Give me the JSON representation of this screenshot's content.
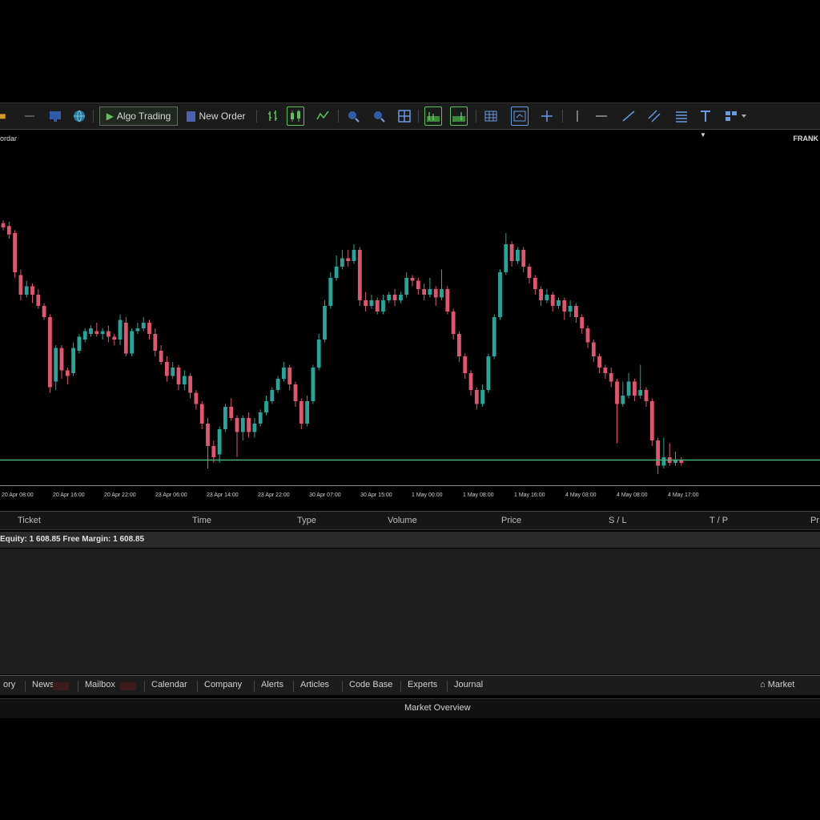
{
  "toolbar": {
    "algo_trading_label": "Algo Trading",
    "new_order_label": "New Order"
  },
  "subbar": {
    "left_label": "ordar",
    "right_label": "FRANK"
  },
  "chart_data": {
    "type": "candlestick",
    "colors": {
      "up": "#26a69a",
      "down": "#e05570",
      "background": "#000000",
      "price_line": "#4caf7a"
    },
    "x_tick_labels": [
      "20 Apr 08:00",
      "20 Apr 16:00",
      "20 Apr 22:00",
      "23 Apr 06:00",
      "23 Apr 14:00",
      "23 Apr 22:00",
      "30 Apr 07:00",
      "30 Apr 15:00",
      "1 May 00:00",
      "1 May 08:00",
      "1 May 16:00",
      "4 May 03:00",
      "4 May 08:00",
      "4 May 17:00"
    ],
    "grid": false,
    "candles": [
      {
        "o": 0.895,
        "c": 0.88,
        "h": 0.905,
        "l": 0.87
      },
      {
        "o": 0.885,
        "c": 0.855,
        "h": 0.9,
        "l": 0.84
      },
      {
        "o": 0.86,
        "c": 0.72,
        "h": 0.87,
        "l": 0.7
      },
      {
        "o": 0.71,
        "c": 0.64,
        "h": 0.73,
        "l": 0.62
      },
      {
        "o": 0.64,
        "c": 0.67,
        "h": 0.69,
        "l": 0.63
      },
      {
        "o": 0.67,
        "c": 0.64,
        "h": 0.68,
        "l": 0.61
      },
      {
        "o": 0.64,
        "c": 0.6,
        "h": 0.66,
        "l": 0.59
      },
      {
        "o": 0.6,
        "c": 0.56,
        "h": 0.61,
        "l": 0.55
      },
      {
        "o": 0.56,
        "c": 0.31,
        "h": 0.57,
        "l": 0.29
      },
      {
        "o": 0.33,
        "c": 0.45,
        "h": 0.46,
        "l": 0.3
      },
      {
        "o": 0.45,
        "c": 0.37,
        "h": 0.46,
        "l": 0.34
      },
      {
        "o": 0.37,
        "c": 0.35,
        "h": 0.38,
        "l": 0.32
      },
      {
        "o": 0.36,
        "c": 0.45,
        "h": 0.47,
        "l": 0.35
      },
      {
        "o": 0.44,
        "c": 0.49,
        "h": 0.5,
        "l": 0.43
      },
      {
        "o": 0.48,
        "c": 0.51,
        "h": 0.52,
        "l": 0.47
      },
      {
        "o": 0.5,
        "c": 0.52,
        "h": 0.53,
        "l": 0.49
      },
      {
        "o": 0.51,
        "c": 0.5,
        "h": 0.54,
        "l": 0.49
      },
      {
        "o": 0.5,
        "c": 0.51,
        "h": 0.52,
        "l": 0.48
      },
      {
        "o": 0.51,
        "c": 0.49,
        "h": 0.53,
        "l": 0.47
      },
      {
        "o": 0.49,
        "c": 0.48,
        "h": 0.5,
        "l": 0.46
      },
      {
        "o": 0.48,
        "c": 0.55,
        "h": 0.57,
        "l": 0.46
      },
      {
        "o": 0.54,
        "c": 0.43,
        "h": 0.56,
        "l": 0.42
      },
      {
        "o": 0.43,
        "c": 0.51,
        "h": 0.52,
        "l": 0.42
      },
      {
        "o": 0.51,
        "c": 0.52,
        "h": 0.54,
        "l": 0.5
      },
      {
        "o": 0.52,
        "c": 0.54,
        "h": 0.56,
        "l": 0.51
      },
      {
        "o": 0.54,
        "c": 0.5,
        "h": 0.55,
        "l": 0.48
      },
      {
        "o": 0.5,
        "c": 0.44,
        "h": 0.52,
        "l": 0.42
      },
      {
        "o": 0.44,
        "c": 0.4,
        "h": 0.46,
        "l": 0.39
      },
      {
        "o": 0.4,
        "c": 0.35,
        "h": 0.42,
        "l": 0.33
      },
      {
        "o": 0.35,
        "c": 0.38,
        "h": 0.4,
        "l": 0.34
      },
      {
        "o": 0.38,
        "c": 0.32,
        "h": 0.39,
        "l": 0.3
      },
      {
        "o": 0.32,
        "c": 0.35,
        "h": 0.37,
        "l": 0.3
      },
      {
        "o": 0.35,
        "c": 0.29,
        "h": 0.36,
        "l": 0.27
      },
      {
        "o": 0.29,
        "c": 0.25,
        "h": 0.3,
        "l": 0.23
      },
      {
        "o": 0.25,
        "c": 0.18,
        "h": 0.26,
        "l": 0.16
      },
      {
        "o": 0.18,
        "c": 0.1,
        "h": 0.2,
        "l": 0.02
      },
      {
        "o": 0.1,
        "c": 0.06,
        "h": 0.12,
        "l": 0.04
      },
      {
        "o": 0.07,
        "c": 0.16,
        "h": 0.17,
        "l": 0.04
      },
      {
        "o": 0.16,
        "c": 0.24,
        "h": 0.25,
        "l": 0.15
      },
      {
        "o": 0.24,
        "c": 0.2,
        "h": 0.27,
        "l": 0.19
      },
      {
        "o": 0.2,
        "c": 0.15,
        "h": 0.21,
        "l": 0.06
      },
      {
        "o": 0.15,
        "c": 0.2,
        "h": 0.21,
        "l": 0.12
      },
      {
        "o": 0.2,
        "c": 0.15,
        "h": 0.22,
        "l": 0.13
      },
      {
        "o": 0.15,
        "c": 0.18,
        "h": 0.2,
        "l": 0.13
      },
      {
        "o": 0.18,
        "c": 0.22,
        "h": 0.23,
        "l": 0.17
      },
      {
        "o": 0.22,
        "c": 0.26,
        "h": 0.28,
        "l": 0.21
      },
      {
        "o": 0.26,
        "c": 0.3,
        "h": 0.31,
        "l": 0.25
      },
      {
        "o": 0.3,
        "c": 0.34,
        "h": 0.35,
        "l": 0.29
      },
      {
        "o": 0.34,
        "c": 0.38,
        "h": 0.4,
        "l": 0.33
      },
      {
        "o": 0.38,
        "c": 0.32,
        "h": 0.39,
        "l": 0.3
      },
      {
        "o": 0.32,
        "c": 0.26,
        "h": 0.33,
        "l": 0.24
      },
      {
        "o": 0.26,
        "c": 0.18,
        "h": 0.27,
        "l": 0.16
      },
      {
        "o": 0.18,
        "c": 0.26,
        "h": 0.28,
        "l": 0.17
      },
      {
        "o": 0.26,
        "c": 0.38,
        "h": 0.39,
        "l": 0.25
      },
      {
        "o": 0.38,
        "c": 0.48,
        "h": 0.5,
        "l": 0.37
      },
      {
        "o": 0.48,
        "c": 0.6,
        "h": 0.62,
        "l": 0.47
      },
      {
        "o": 0.6,
        "c": 0.7,
        "h": 0.72,
        "l": 0.59
      },
      {
        "o": 0.7,
        "c": 0.74,
        "h": 0.78,
        "l": 0.69
      },
      {
        "o": 0.74,
        "c": 0.77,
        "h": 0.8,
        "l": 0.73
      },
      {
        "o": 0.77,
        "c": 0.76,
        "h": 0.8,
        "l": 0.74
      },
      {
        "o": 0.76,
        "c": 0.8,
        "h": 0.82,
        "l": 0.75
      },
      {
        "o": 0.8,
        "c": 0.62,
        "h": 0.81,
        "l": 0.6
      },
      {
        "o": 0.62,
        "c": 0.6,
        "h": 0.65,
        "l": 0.58
      },
      {
        "o": 0.6,
        "c": 0.62,
        "h": 0.64,
        "l": 0.59
      },
      {
        "o": 0.62,
        "c": 0.58,
        "h": 0.63,
        "l": 0.57
      },
      {
        "o": 0.58,
        "c": 0.62,
        "h": 0.64,
        "l": 0.57
      },
      {
        "o": 0.62,
        "c": 0.64,
        "h": 0.65,
        "l": 0.61
      },
      {
        "o": 0.64,
        "c": 0.62,
        "h": 0.66,
        "l": 0.6
      },
      {
        "o": 0.62,
        "c": 0.64,
        "h": 0.65,
        "l": 0.61
      },
      {
        "o": 0.64,
        "c": 0.7,
        "h": 0.72,
        "l": 0.63
      },
      {
        "o": 0.7,
        "c": 0.69,
        "h": 0.71,
        "l": 0.67
      },
      {
        "o": 0.69,
        "c": 0.66,
        "h": 0.7,
        "l": 0.64
      },
      {
        "o": 0.66,
        "c": 0.64,
        "h": 0.68,
        "l": 0.62
      },
      {
        "o": 0.64,
        "c": 0.66,
        "h": 0.7,
        "l": 0.63
      },
      {
        "o": 0.66,
        "c": 0.63,
        "h": 0.67,
        "l": 0.6
      },
      {
        "o": 0.63,
        "c": 0.66,
        "h": 0.73,
        "l": 0.62
      },
      {
        "o": 0.66,
        "c": 0.58,
        "h": 0.67,
        "l": 0.57
      },
      {
        "o": 0.58,
        "c": 0.5,
        "h": 0.59,
        "l": 0.48
      },
      {
        "o": 0.5,
        "c": 0.42,
        "h": 0.51,
        "l": 0.4
      },
      {
        "o": 0.42,
        "c": 0.36,
        "h": 0.43,
        "l": 0.34
      },
      {
        "o": 0.36,
        "c": 0.3,
        "h": 0.37,
        "l": 0.28
      },
      {
        "o": 0.3,
        "c": 0.25,
        "h": 0.31,
        "l": 0.23
      },
      {
        "o": 0.25,
        "c": 0.3,
        "h": 0.32,
        "l": 0.24
      },
      {
        "o": 0.3,
        "c": 0.42,
        "h": 0.43,
        "l": 0.29
      },
      {
        "o": 0.42,
        "c": 0.56,
        "h": 0.57,
        "l": 0.41
      },
      {
        "o": 0.56,
        "c": 0.72,
        "h": 0.73,
        "l": 0.55
      },
      {
        "o": 0.72,
        "c": 0.82,
        "h": 0.86,
        "l": 0.71
      },
      {
        "o": 0.82,
        "c": 0.76,
        "h": 0.83,
        "l": 0.74
      },
      {
        "o": 0.76,
        "c": 0.8,
        "h": 0.81,
        "l": 0.75
      },
      {
        "o": 0.8,
        "c": 0.74,
        "h": 0.81,
        "l": 0.72
      },
      {
        "o": 0.74,
        "c": 0.7,
        "h": 0.75,
        "l": 0.68
      },
      {
        "o": 0.7,
        "c": 0.66,
        "h": 0.71,
        "l": 0.64
      },
      {
        "o": 0.66,
        "c": 0.62,
        "h": 0.67,
        "l": 0.6
      },
      {
        "o": 0.62,
        "c": 0.64,
        "h": 0.66,
        "l": 0.61
      },
      {
        "o": 0.64,
        "c": 0.6,
        "h": 0.65,
        "l": 0.58
      },
      {
        "o": 0.6,
        "c": 0.62,
        "h": 0.63,
        "l": 0.59
      },
      {
        "o": 0.62,
        "c": 0.58,
        "h": 0.63,
        "l": 0.55
      },
      {
        "o": 0.58,
        "c": 0.6,
        "h": 0.62,
        "l": 0.56
      },
      {
        "o": 0.6,
        "c": 0.56,
        "h": 0.61,
        "l": 0.54
      },
      {
        "o": 0.56,
        "c": 0.52,
        "h": 0.57,
        "l": 0.5
      },
      {
        "o": 0.52,
        "c": 0.47,
        "h": 0.53,
        "l": 0.45
      },
      {
        "o": 0.47,
        "c": 0.42,
        "h": 0.48,
        "l": 0.4
      },
      {
        "o": 0.42,
        "c": 0.38,
        "h": 0.43,
        "l": 0.36
      },
      {
        "o": 0.38,
        "c": 0.36,
        "h": 0.39,
        "l": 0.34
      },
      {
        "o": 0.36,
        "c": 0.33,
        "h": 0.38,
        "l": 0.31
      },
      {
        "o": 0.33,
        "c": 0.25,
        "h": 0.34,
        "l": 0.11
      },
      {
        "o": 0.25,
        "c": 0.28,
        "h": 0.33,
        "l": 0.24
      },
      {
        "o": 0.28,
        "c": 0.33,
        "h": 0.36,
        "l": 0.27
      },
      {
        "o": 0.33,
        "c": 0.28,
        "h": 0.34,
        "l": 0.26
      },
      {
        "o": 0.28,
        "c": 0.3,
        "h": 0.39,
        "l": 0.27
      },
      {
        "o": 0.3,
        "c": 0.26,
        "h": 0.31,
        "l": 0.24
      },
      {
        "o": 0.26,
        "c": 0.12,
        "h": 0.27,
        "l": 0.1
      },
      {
        "o": 0.12,
        "c": 0.03,
        "h": 0.13,
        "l": 0.0
      },
      {
        "o": 0.03,
        "c": 0.06,
        "h": 0.13,
        "l": 0.02
      },
      {
        "o": 0.06,
        "c": 0.04,
        "h": 0.11,
        "l": 0.03
      },
      {
        "o": 0.04,
        "c": 0.05,
        "h": 0.08,
        "l": 0.03
      },
      {
        "o": 0.05,
        "c": 0.04,
        "h": 0.06,
        "l": 0.03
      }
    ],
    "price_level": 0.05
  },
  "trade_table": {
    "columns": [
      "Ticket",
      "Time",
      "Type",
      "Volume",
      "Price",
      "S / L",
      "T / P",
      "Pr"
    ]
  },
  "balance": {
    "text": "Equity: 1 608.85  Free Margin: 1 608.85"
  },
  "tabs": {
    "items": [
      "ory",
      "News",
      "Mailbox",
      "Calendar",
      "Company",
      "Alerts",
      "Articles",
      "Code Base",
      "Experts",
      "Journal"
    ],
    "market_label": "Market"
  },
  "market_overview": {
    "label": "Market Overview"
  }
}
